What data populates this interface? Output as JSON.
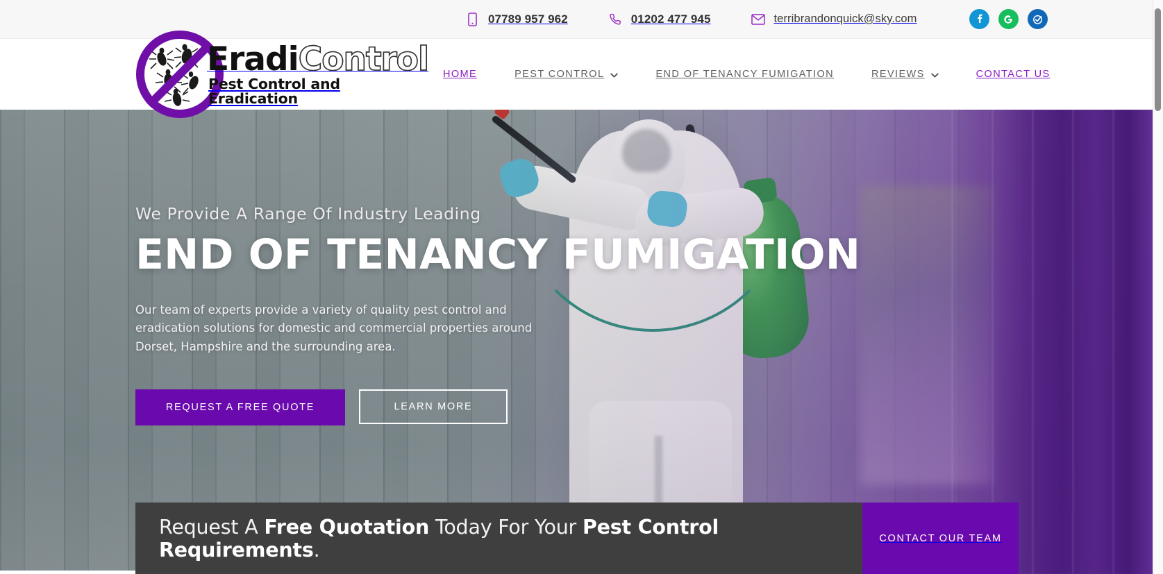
{
  "topbar": {
    "contacts": [
      {
        "icon": "mobile-phone-icon",
        "label": "07789 957 962"
      },
      {
        "icon": "telephone-icon",
        "label": "01202 477 945"
      },
      {
        "icon": "envelope-icon",
        "label": "terribrandonquick@sky.com"
      }
    ],
    "social": [
      {
        "icon": "facebook-icon",
        "name": "Facebook",
        "color": "#1195d4"
      },
      {
        "icon": "google-icon",
        "name": "Google",
        "color": "#17bd5f"
      },
      {
        "icon": "checkatrade-icon",
        "name": "Checkatrade",
        "color": "#1268b8"
      }
    ]
  },
  "brand": {
    "word_first": "Eradi",
    "word_second": "Control",
    "tagline": "Pest Control and Eradication",
    "logo_icon": "no-pests-circle-icon",
    "accent_purple": "#6f0fa8"
  },
  "nav": {
    "items": [
      {
        "label": "HOME",
        "active": true,
        "dropdown": false
      },
      {
        "label": "PEST CONTROL",
        "active": false,
        "dropdown": true
      },
      {
        "label": "END OF TENANCY FUMIGATION",
        "active": false,
        "dropdown": false
      },
      {
        "label": "REVIEWS",
        "active": false,
        "dropdown": true
      },
      {
        "label": "CONTACT US",
        "active": true,
        "dropdown": false
      }
    ]
  },
  "hero": {
    "kicker": "We Provide A Range Of Industry Leading",
    "title": "END OF TENANCY FUMIGATION",
    "paragraph": "Our team of experts provide a variety of quality pest control and eradication solutions for domestic and commercial properties around Dorset, Hampshire and the surrounding area.",
    "primary_button": "REQUEST A FREE QUOTE",
    "secondary_button": "LEARN MORE",
    "primary_button_color": "#6a09ad",
    "image_alt": "pest-control-technician-spraying"
  },
  "cta": {
    "text_parts": [
      {
        "text": "Request A ",
        "bold": false
      },
      {
        "text": "Free Quotation",
        "bold": true
      },
      {
        "text": " Today For Your ",
        "bold": false
      },
      {
        "text": "Pest Control Requirements",
        "bold": true
      },
      {
        "text": ".",
        "bold": false
      }
    ],
    "text_plain": "Request A Free Quotation Today For Your Pest Control Requirements.",
    "button": "CONTACT OUR TEAM",
    "button_color": "#6a09ad",
    "bar_color": "#3f3f3f"
  }
}
